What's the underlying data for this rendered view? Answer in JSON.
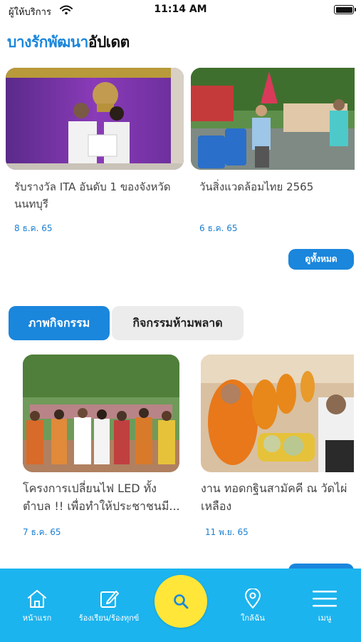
{
  "status_bar": {
    "carrier": "ผู้ให้บริการ",
    "time": "11:14 AM"
  },
  "header": {
    "title_blue": "บางรักพัฒนา",
    "title_dark": "อัปเดต"
  },
  "news": [
    {
      "title": "รับรางวัล ITA อันดับ 1 ของจังหวัดนนทบุรี",
      "date": "8 ธ.ค. 65"
    },
    {
      "title": "วันสิ่งแวดล้อมไทย 2565",
      "date": "6 ธ.ค. 65"
    }
  ],
  "see_all_label": "ดูทั้งหมด",
  "tabs": [
    {
      "label": "ภาพกิจกรรม",
      "active": true
    },
    {
      "label": "กิจกรรมห้ามพลาด",
      "active": false
    }
  ],
  "activities": [
    {
      "title_line1": "โครงการเปลี่ยนไฟ LED ทั้ง",
      "title_line2": "ตำบล !! เพื่อทำให้ประชาชนมี...",
      "date": "7 ธ.ค. 65"
    },
    {
      "title_line1": "งาน ทอดกฐินสามัคคี ณ วัดไผ่",
      "title_line2": "เหลือง",
      "date": "11 พ.ย. 65"
    }
  ],
  "bottom_nav": {
    "home": "หน้าแรก",
    "complaint": "ร้องเรียน/ร้องทุกข์",
    "nearby": "ใกล้ฉัน",
    "menu": "เมนู"
  },
  "colors": {
    "accent": "#1a86dc",
    "nav_bg": "#1cb4ee",
    "fab": "#ffe638"
  },
  "icons": [
    "wifi-icon",
    "battery-icon",
    "home-icon",
    "edit-icon",
    "search-icon",
    "location-pin-icon",
    "hamburger-menu-icon"
  ]
}
